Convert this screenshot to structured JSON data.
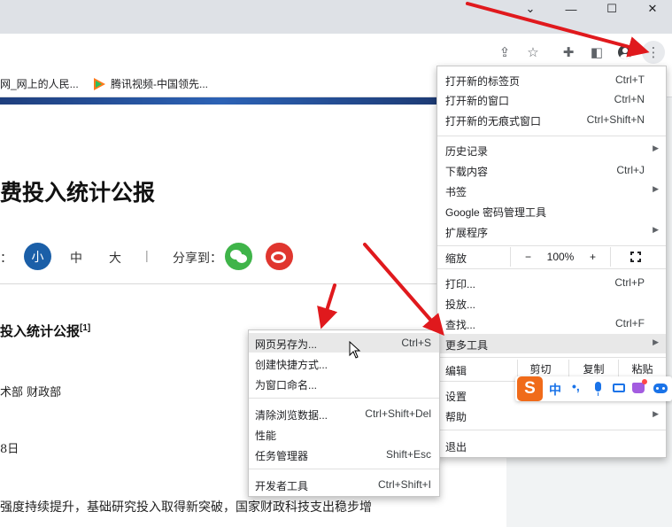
{
  "window": {
    "minimize_icon": "minimize-icon",
    "maximize_icon": "maximize-icon",
    "close_icon": "close-icon",
    "chevron_icon": "chevron-down-icon"
  },
  "toolbar": {
    "icons": [
      "share-icon",
      "star-icon",
      "extensions-icon",
      "side-panel-icon",
      "profile-icon",
      "kebab-menu-icon"
    ]
  },
  "bookmarks": [
    {
      "label": "网_网上的人民..."
    },
    {
      "label": "腾讯视频-中国领先..."
    }
  ],
  "article": {
    "title": "费投入统计公报",
    "font_size_label": "：",
    "font_small": "小",
    "font_medium": "中",
    "font_large": "大",
    "separator": "|",
    "share_label": "分享到：",
    "subtitle": "投入统计公报",
    "subtitle_sup": "[1]",
    "dept": "术部  财政部",
    "date": "8日",
    "body": "强度持续提升，基础研究投入取得新突破，国家财政科技支出稳步增"
  },
  "menu": {
    "new_tab": {
      "label": "打开新的标签页",
      "shortcut": "Ctrl+T"
    },
    "new_window": {
      "label": "打开新的窗口",
      "shortcut": "Ctrl+N"
    },
    "incognito": {
      "label": "打开新的无痕式窗口",
      "shortcut": "Ctrl+Shift+N"
    },
    "history": {
      "label": "历史记录"
    },
    "downloads": {
      "label": "下载内容",
      "shortcut": "Ctrl+J"
    },
    "bookmarks": {
      "label": "书签"
    },
    "password": {
      "label": "Google 密码管理工具"
    },
    "extensions": {
      "label": "扩展程序"
    },
    "zoom": {
      "label": "缩放",
      "minus": "−",
      "value": "100%",
      "plus": "+"
    },
    "print": {
      "label": "打印...",
      "shortcut": "Ctrl+P"
    },
    "cast": {
      "label": "投放..."
    },
    "find": {
      "label": "查找...",
      "shortcut": "Ctrl+F"
    },
    "more_tools": {
      "label": "更多工具"
    },
    "edit": {
      "label": "编辑",
      "cut": "剪切",
      "copy": "复制",
      "paste": "粘贴"
    },
    "settings": {
      "label": "设置"
    },
    "help": {
      "label": "帮助"
    },
    "exit": {
      "label": "退出"
    }
  },
  "submenu": {
    "save_as": {
      "label": "网页另存为...",
      "shortcut": "Ctrl+S"
    },
    "shortcut": {
      "label": "创建快捷方式..."
    },
    "name_window": {
      "label": "为窗口命名..."
    },
    "clear_data": {
      "label": "清除浏览数据...",
      "shortcut": "Ctrl+Shift+Del"
    },
    "performance": {
      "label": "性能"
    },
    "task_manager": {
      "label": "任务管理器",
      "shortcut": "Shift+Esc"
    },
    "devtools": {
      "label": "开发者工具",
      "shortcut": "Ctrl+Shift+I"
    }
  },
  "ime": {
    "logo": "S",
    "lang": "中",
    "punct": "•,",
    "colors": {
      "logo_bg": "#f06b1a",
      "accent": "#1a73e8"
    }
  },
  "colors": {
    "arrow": "#e0191d",
    "menu_highlight": "#e8e8e8"
  }
}
